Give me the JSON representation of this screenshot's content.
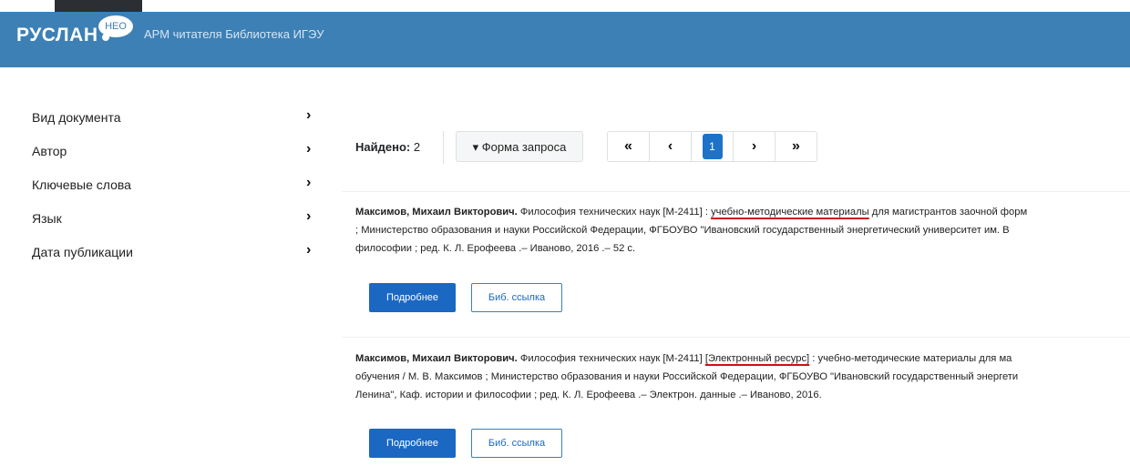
{
  "header": {
    "logo": "РУСЛАН",
    "logo_badge": "НЕО",
    "title": "АРМ читателя Библиотека ИГЭУ"
  },
  "sidebar": {
    "items": [
      {
        "label": "Вид документа",
        "icon": "chevron-right-icon"
      },
      {
        "label": "Автор",
        "icon": "chevron-right-icon"
      },
      {
        "label": "Ключевые слова",
        "icon": "chevron-right-icon"
      },
      {
        "label": "Язык",
        "icon": "chevron-right-icon"
      },
      {
        "label": "Дата публикации",
        "icon": "chevron-right-icon"
      }
    ]
  },
  "toolbar": {
    "found_label": "Найдено:",
    "found_count": "2",
    "query_form": "▾ Форма запроса",
    "pager": {
      "first": "«",
      "prev": "‹",
      "current": "1",
      "next": "›",
      "last": "»"
    }
  },
  "results": [
    {
      "author": "Максимов, Михаил Викторович.",
      "line1_pre": " Философия технических наук [М-2411] : ",
      "line1_mark": "учебно-методические материалы",
      "line1_post": " для магистрантов заочной форм",
      "line2": "; Министерство образования и науки Российской Федерации, ФГБОУВО \"Ивановский государственный энергетический университет им. В",
      "line3": "философии ; ред. К. Л. Ерофеева .– Иваново, 2016 .– 52 с.",
      "more": "Подробнее",
      "ref": "Биб. ссылка"
    },
    {
      "author": "Максимов, Михаил Викторович.",
      "line1_pre": " Философия технических наук [М-2411] ",
      "line1_mark": "[Электронный ресурс]",
      "line1_post": " : учебно-методические материалы для ма",
      "line2": "обучения / М. В. Максимов ; Министерство образования и науки Российской Федерации, ФГБОУВО \"Ивановский государственный энергети",
      "line3": "Ленина\", Каф. истории и философии ; ред. К. Л. Ерофеева .– Электрон. данные .– Иваново, 2016.",
      "more": "Подробнее",
      "ref": "Биб. ссылка"
    }
  ],
  "colors": {
    "header": "#3c80b6",
    "primary": "#1a68c2",
    "underline": "#d01010"
  }
}
